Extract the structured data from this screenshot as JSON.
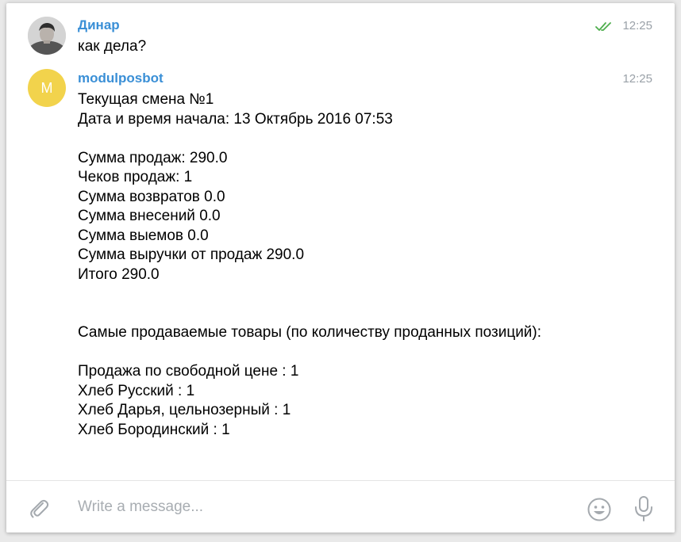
{
  "messages": [
    {
      "sender": "Динар",
      "time": "12:25",
      "status_icon": "double-check-icon",
      "avatar": "user-photo",
      "text": "как дела?"
    },
    {
      "sender": "modulposbot",
      "time": "12:25",
      "avatar_letter": "M",
      "avatar_color": "#f2d34c",
      "text": "Текущая смена №1\nДата и время начала: 13 Октябрь 2016 07:53\n\nСумма продаж: 290.0\nЧеков продаж: 1\nСумма возвратов 0.0\nСумма внесений 0.0\nСумма выемов 0.0\nСумма выручки от продаж 290.0\nИтого 290.0\n\n\nСамые продаваемые товары (по количеству проданных позиций):\n\nПродажа по свободной цене : 1\nХлеб Русский : 1\nХлеб Дарья, цельнозерный : 1\nХлеб Бородинский : 1"
    }
  ],
  "composer": {
    "placeholder": "Write a message...",
    "attach_icon": "paperclip-icon",
    "emoji_icon": "smiley-icon",
    "mic_icon": "microphone-icon"
  },
  "colors": {
    "sender_name": "#3a8fd6",
    "read_check": "#4fae4e",
    "timestamp": "#9aa1a8"
  }
}
